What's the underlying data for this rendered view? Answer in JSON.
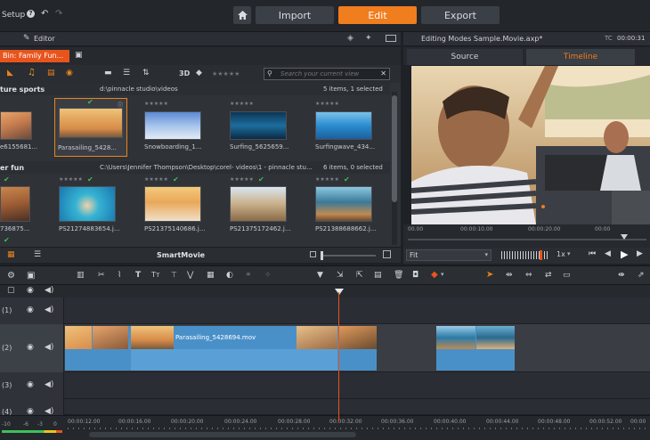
{
  "topbar": {
    "setup_label": "Setup",
    "tabs": [
      {
        "label": "Import"
      },
      {
        "label": "Edit"
      },
      {
        "label": "Export"
      }
    ]
  },
  "library": {
    "editor_label": "Editor",
    "bin_label": "Bin: Family Fun...",
    "view_3d": "3D",
    "search_placeholder": "Search your current view",
    "smartmovie_label": "SmartMovie",
    "groups": [
      {
        "name": "ture sports",
        "path": "d:\\pinnacle studio\\videos",
        "count": "5 items, 1 selected",
        "clips": [
          {
            "label": "e615568​1...",
            "type": "video"
          },
          {
            "label": "Parasailing_5428...",
            "type": "video",
            "selected": true
          },
          {
            "label": "Snowboarding_1...",
            "type": "video"
          },
          {
            "label": "Surfing_5625659...",
            "type": "video"
          },
          {
            "label": "Surfingwave_434...",
            "type": "video"
          }
        ]
      },
      {
        "name": "er fun",
        "path": "C:\\Users\\Jennifer Thompson\\Desktop\\corel- videos\\1 - pinnacle stu...",
        "count": "6 items, 0 selected",
        "clips": [
          {
            "label": "736875...",
            "type": "image"
          },
          {
            "label": "PS21274883654.j...",
            "type": "image"
          },
          {
            "label": "PS21375140686.j...",
            "type": "image"
          },
          {
            "label": "PS21375172462.j...",
            "type": "image"
          },
          {
            "label": "PS21388688662.j...",
            "type": "image"
          }
        ]
      }
    ]
  },
  "player": {
    "title": "Editing Modes Sample.Movie.axp*",
    "tc_label": "TC",
    "timecode": "00:00:31",
    "tabs": [
      {
        "label": "Source"
      },
      {
        "label": "Timeline"
      }
    ],
    "ruler": [
      "00.00",
      "00:00:10.00",
      "00:00:20.00",
      "00:00"
    ],
    "fit_label": "Fit",
    "speed_label": "1x"
  },
  "timeline": {
    "tracks": [
      {
        "label": "(1)"
      },
      {
        "label": "(2)"
      },
      {
        "label": "(3)"
      },
      {
        "label": "(4)"
      }
    ],
    "main_clip_label": "Parasailing_5428694.mov",
    "ruler": [
      "00:00:12.00",
      "00:00:16.00",
      "00:00:20.00",
      "00:00:24.00",
      "00:00:28.00",
      "00:00:32.00",
      "00:00:36.00",
      "00:00:40.00",
      "00:00:44.00",
      "00:00:48.00",
      "00:00:52.00",
      "00:00"
    ],
    "meter": [
      "-10",
      "-6",
      "-3",
      "0"
    ]
  }
}
